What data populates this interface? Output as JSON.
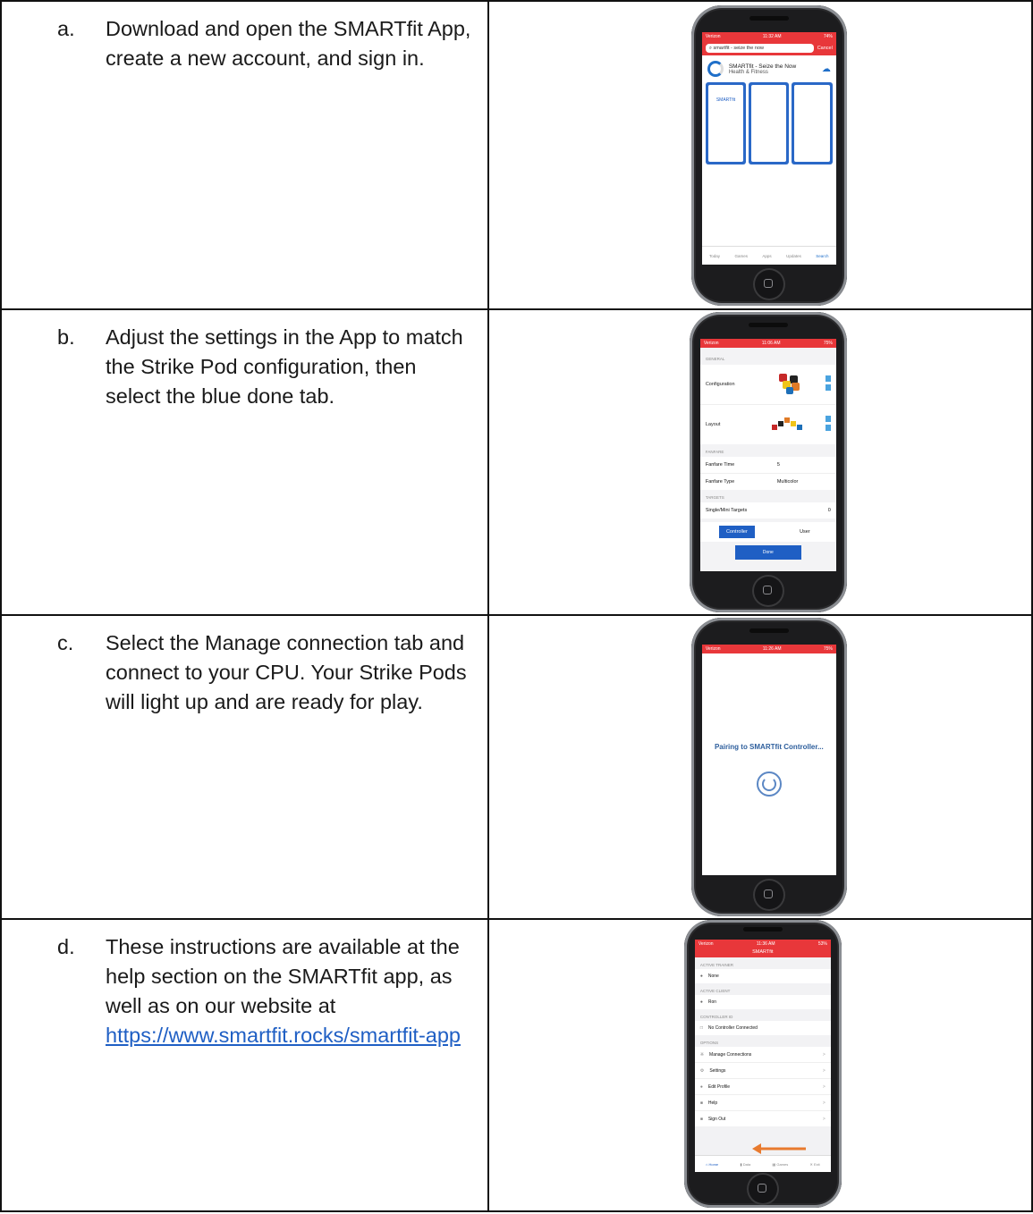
{
  "steps": [
    {
      "letter": "a.",
      "text": "Download and open the SMARTfit App, create a new account, and sign in."
    },
    {
      "letter": "b.",
      "text": "Adjust the settings in the App to match the Strike Pod configuration, then select the blue done tab."
    },
    {
      "letter": "c.",
      "text": "Select the Manage connection tab and connect to your CPU. Your Strike Pods will light up and are ready for play."
    },
    {
      "letter": "d.",
      "text_before": "These instructions are available at the help section on the SMARTfit app, as well as on our website at ",
      "link": "https://www.smartfit.rocks/smartfit-app"
    }
  ],
  "phone_a": {
    "status_carrier": "Verizon",
    "status_time": "11:32 AM",
    "status_battery": "74%",
    "search_query": "smartfit - seize the now",
    "cancel": "Cancel",
    "app_name": "SMARTfit - Seize the Now",
    "app_category": "Health & Fitness",
    "shot_logo": "SMARTfit",
    "tabs": [
      "Today",
      "Games",
      "Apps",
      "Updates",
      "Search"
    ]
  },
  "phone_b": {
    "status_carrier": "Verizon",
    "status_time": "11:06 AM",
    "status_battery": "75%",
    "section_general": "GENERAL",
    "configuration": "Configuration",
    "layout": "Layout",
    "section_fanfare": "FANFARE",
    "fanfare_time_label": "Fanfare Time",
    "fanfare_time_value": "5",
    "fanfare_type_label": "Fanfare Type",
    "fanfare_type_value": "Multicolor",
    "section_targets": "TARGETS",
    "single_mini_targets": "Single/Mini Targets",
    "targets_value": "0",
    "controller_btn": "Controller",
    "user_btn": "User",
    "done_btn": "Done"
  },
  "phone_c": {
    "status_carrier": "Verizon",
    "status_time": "11:26 AM",
    "status_battery": "75%",
    "pairing_text": "Pairing to SMARTfit Controller..."
  },
  "phone_d": {
    "status_carrier": "Verizon",
    "status_time": "11:36 AM",
    "status_battery": "53%",
    "title": "SMARTfit",
    "active_trainer_header": "ACTIVE TRAINER",
    "active_trainer": "None",
    "active_client_header": "ACTIVE CLIENT",
    "active_client": "Ron",
    "controller_id_header": "CONTROLLER ID",
    "controller_status": "No Controller Connected",
    "options_header": "OPTIONS",
    "options": [
      "Manage Connections",
      "Settings",
      "Edit Profile",
      "Help",
      "Sign Out"
    ],
    "arrow_color": "#e87a2e",
    "tabs": [
      "Home",
      "Data",
      "Games",
      "Exit"
    ]
  }
}
